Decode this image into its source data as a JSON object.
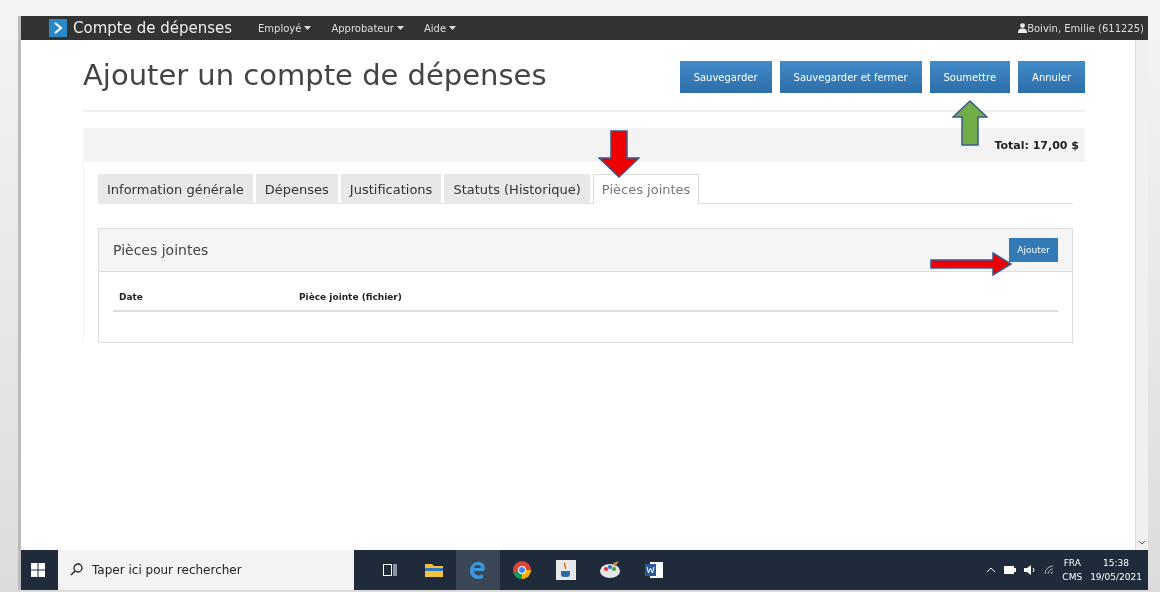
{
  "navbar": {
    "brand": "Compte de dépenses",
    "menus": [
      "Employé",
      "Approbateur",
      "Aide"
    ],
    "user": "Boivin, Emilie (611225)"
  },
  "page": {
    "title": "Ajouter un compte de dépenses",
    "buttons": [
      "Sauvegarder",
      "Sauvegarder et fermer",
      "Soumettre",
      "Annuler"
    ],
    "total": "Total: 17,00 $"
  },
  "tabs": [
    {
      "label": "Information générale",
      "selected": false
    },
    {
      "label": "Dépenses",
      "selected": false
    },
    {
      "label": "Justifications",
      "selected": false
    },
    {
      "label": "Statuts (Historique)",
      "selected": false
    },
    {
      "label": "Pièces jointes",
      "selected": true
    }
  ],
  "panel": {
    "title": "Pièces jointes",
    "add_button": "Ajouter",
    "columns": [
      "Date",
      "Pièce jointe (fichier)"
    ]
  },
  "taskbar": {
    "search_placeholder": "Taper ici pour rechercher",
    "language": "FRA",
    "layout": "CMS",
    "time": "15:38",
    "date": "19/05/2021"
  }
}
